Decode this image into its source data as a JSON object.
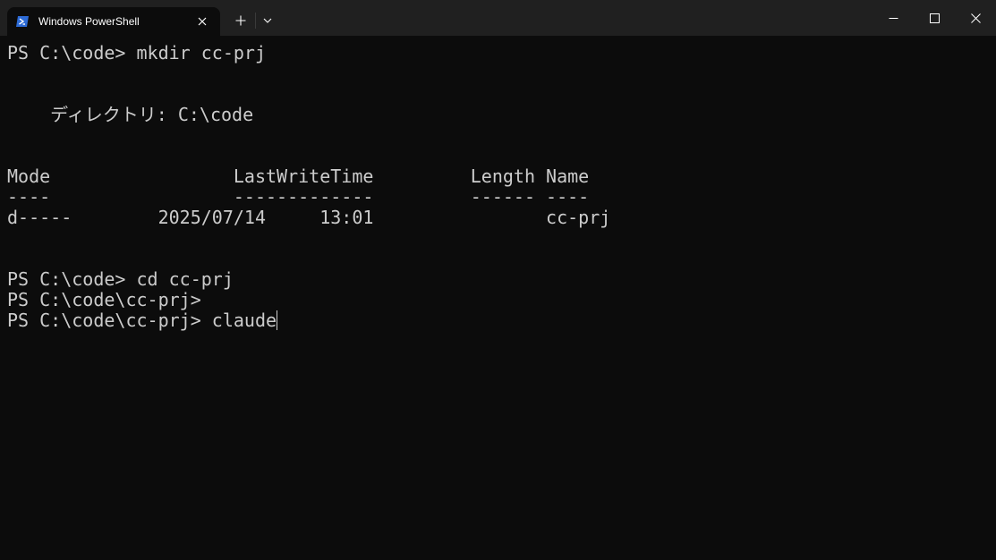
{
  "window": {
    "tab_title": "Windows PowerShell",
    "tab_icon": "powershell-icon",
    "close_tab_icon": "close-icon",
    "new_tab_icon": "plus-icon",
    "dropdown_icon": "chevron-down-icon",
    "minimize_icon": "minimize-icon",
    "maximize_icon": "maximize-icon",
    "close_window_icon": "close-icon",
    "colors": {
      "titlebar": "#202020",
      "terminal_bg": "#0c0c0c",
      "text": "#cccccc",
      "icon_accent": "#2d6bd6"
    }
  },
  "terminal": {
    "lines": [
      "PS C:\\code> mkdir cc-prj",
      "",
      "",
      "    ディレクトリ: C:\\code",
      "",
      "",
      "Mode                 LastWriteTime         Length Name",
      "----                 -------------         ------ ----",
      "d-----        2025/07/14     13:01                cc-prj",
      "",
      "",
      "PS C:\\code> cd cc-prj",
      "PS C:\\code\\cc-prj>",
      "PS C:\\code\\cc-prj> claude"
    ]
  }
}
